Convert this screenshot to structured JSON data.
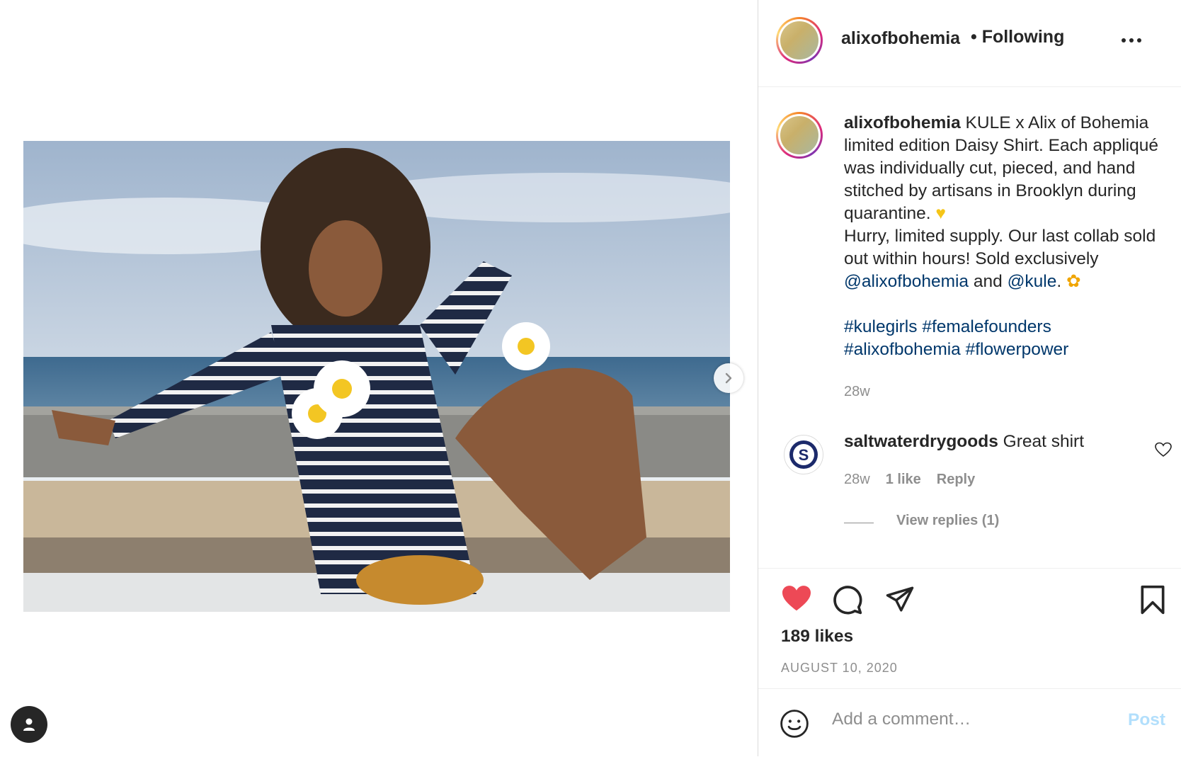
{
  "post": {
    "username": "alixofbohemia",
    "follow_status": "• Following",
    "caption": {
      "username": "alixofbohemia",
      "line1": "KULE x Alix of Bohemia limited edition Daisy Shirt. Each appliqué was individually cut, pieced, and hand stitched by artisans in Brooklyn during quarantine.",
      "line2": "Hurry, limited supply. Our last collab sold out within hours! Sold exclusively",
      "mention1": "@alixofbohemia",
      "and_text": "and",
      "mention2": "@kule",
      "period": ".",
      "hashtags": [
        "#kulegirls",
        "#femalefounders",
        "#alixofbohemia",
        "#flowerpower"
      ],
      "time": "28w"
    },
    "comment": {
      "username": "saltwaterdrygoods",
      "text": "Great shirt",
      "time": "28w",
      "likes": "1 like",
      "reply": "Reply",
      "view_replies": "View replies (1)"
    },
    "likes": "189 likes",
    "date": "AUGUST 10, 2020",
    "comment_placeholder": "Add a comment…",
    "post_button": "Post"
  },
  "icons": {
    "more": "more-options-icon",
    "like": "heart-filled-icon",
    "comment": "comment-bubble-icon",
    "share": "paper-plane-icon",
    "save": "bookmark-icon",
    "emoji": "smiley-icon",
    "next": "chevron-right-icon",
    "profile": "person-icon"
  },
  "colors": {
    "like_red": "#ed4956",
    "link_blue": "#00376b",
    "muted": "#8e8e8e",
    "post_disabled": "#b2dffc"
  }
}
